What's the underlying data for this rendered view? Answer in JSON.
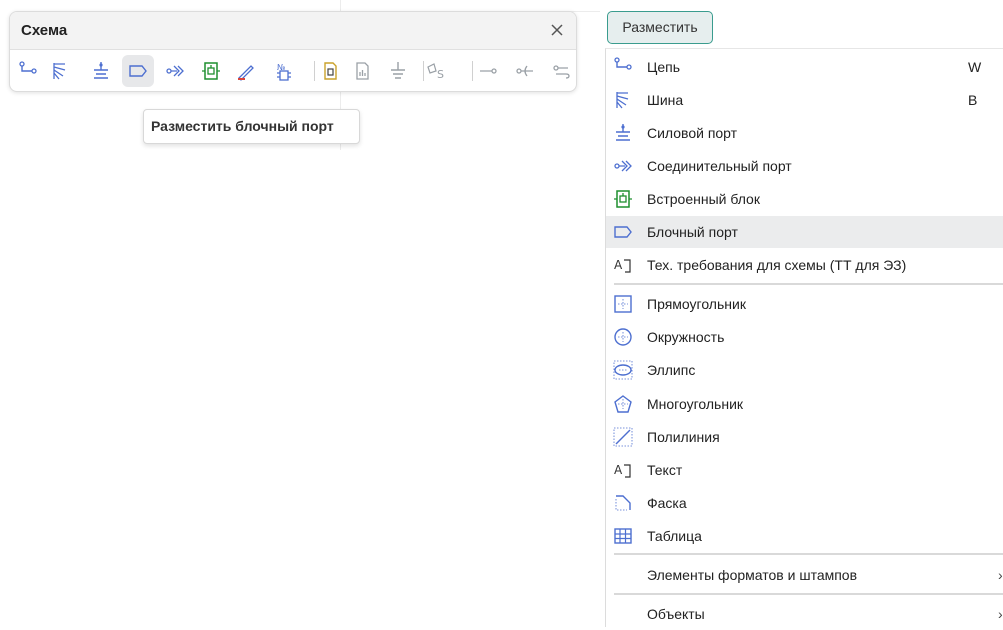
{
  "panel": {
    "title": "Схема",
    "close_glyph": "✕",
    "tools": [
      {
        "name": "circuit-icon",
        "active": false
      },
      {
        "name": "bus-icon",
        "active": false
      },
      {
        "name": "power-port-icon",
        "active": false
      },
      {
        "name": "block-port-icon",
        "active": true
      },
      {
        "name": "connector-port-icon",
        "active": false
      },
      {
        "name": "embedded-block-icon",
        "active": false
      },
      {
        "name": "pen-icon",
        "active": false
      },
      {
        "name": "numbering-icon",
        "active": false
      },
      {
        "name": "document-icon",
        "active": false
      },
      {
        "name": "report-icon",
        "active": false
      },
      {
        "name": "ground-icon",
        "active": false
      },
      {
        "name": "technical-spec-icon",
        "active": false
      },
      {
        "name": "line-end-icon",
        "active": false
      },
      {
        "name": "line-fork-icon",
        "active": false
      },
      {
        "name": "line-loop-icon",
        "active": false
      }
    ]
  },
  "tooltip": {
    "text": "Разместить блочный порт"
  },
  "place_button": {
    "label": "Разместить"
  },
  "menu": {
    "items": [
      {
        "icon": "circuit-icon",
        "label": "Цепь",
        "shortcut": "W",
        "highlighted": false
      },
      {
        "icon": "bus-icon",
        "label": "Шина",
        "shortcut": "B",
        "highlighted": false
      },
      {
        "icon": "power-port-icon",
        "label": "Силовой порт",
        "shortcut": "",
        "highlighted": false
      },
      {
        "icon": "connector-port-icon",
        "label": "Соединительный порт",
        "shortcut": "",
        "highlighted": false
      },
      {
        "icon": "embedded-block-icon",
        "label": "Встроенный блок",
        "shortcut": "",
        "highlighted": false
      },
      {
        "icon": "block-port-icon",
        "label": "Блочный порт",
        "shortcut": "",
        "highlighted": true
      },
      {
        "icon": "text-frame-icon",
        "label": "Тех. требования для схемы (ТТ для ЭЗ)",
        "shortcut": "",
        "highlighted": false
      },
      {
        "icon": "rectangle-icon",
        "label": "Прямоугольник",
        "shortcut": "",
        "highlighted": false
      },
      {
        "icon": "circle-icon",
        "label": "Окружность",
        "shortcut": "",
        "highlighted": false
      },
      {
        "icon": "ellipse-icon",
        "label": "Эллипс",
        "shortcut": "",
        "highlighted": false
      },
      {
        "icon": "polygon-icon",
        "label": "Многоугольник",
        "shortcut": "",
        "highlighted": false
      },
      {
        "icon": "polyline-icon",
        "label": "Полилиния",
        "shortcut": "",
        "highlighted": false
      },
      {
        "icon": "text-frame-icon",
        "label": "Текст",
        "shortcut": "",
        "highlighted": false
      },
      {
        "icon": "chamfer-icon",
        "label": "Фаска",
        "shortcut": "",
        "highlighted": false
      },
      {
        "icon": "table-icon",
        "label": "Таблица",
        "shortcut": "",
        "highlighted": false
      },
      {
        "icon": "",
        "label": "Элементы форматов и штампов",
        "shortcut": "",
        "highlighted": false,
        "submenu": "›"
      },
      {
        "icon": "",
        "label": "Объекты",
        "shortcut": "",
        "highlighted": false,
        "submenu": "›"
      }
    ]
  },
  "colors": {
    "icon_blue": "#4d6fd0",
    "icon_green": "#1f8f2f",
    "icon_red": "#d8433b",
    "button_border": "#3a9c8e",
    "highlight_bg": "#ebeced"
  }
}
